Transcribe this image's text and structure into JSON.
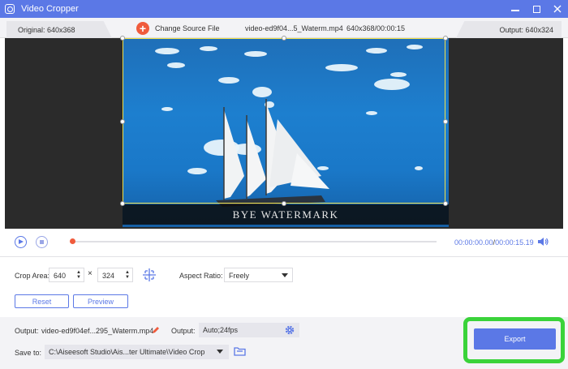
{
  "window": {
    "title": "Video Cropper",
    "icon": "video-cropper-icon"
  },
  "infobar": {
    "original": "Original: 640x368",
    "change_source": "Change Source File",
    "filename": "video-ed9f04...5_Waterm.mp4",
    "fileinfo": "640x368/00:00:15",
    "output": "Output: 640x324"
  },
  "video": {
    "watermark_text": "BYE WATERMARK",
    "crop_border_color": "#f2e04a"
  },
  "playback": {
    "current_time": "00:00:00.00",
    "separator": "/",
    "total_time": "00:00:15.19"
  },
  "crop": {
    "area_label": "Crop Area:",
    "width": "640",
    "times_sign": "×",
    "height": "324",
    "aspect_label": "Aspect Ratio:",
    "aspect_value": "Freely",
    "reset_label": "Reset",
    "preview_label": "Preview"
  },
  "output_panel": {
    "output_label": "Output:",
    "output_filename": "video-ed9f04ef...295_Waterm.mp4",
    "format_label": "Output:",
    "format_value": "Auto;24fps",
    "save_label": "Save to:",
    "save_path": "C:\\Aiseesoft Studio\\Ais...ter Ultimate\\Video Crop",
    "export_label": "Export"
  },
  "colors": {
    "accent": "#5b78e6",
    "add_button": "#f05b3c",
    "highlight": "#3ad33a"
  }
}
